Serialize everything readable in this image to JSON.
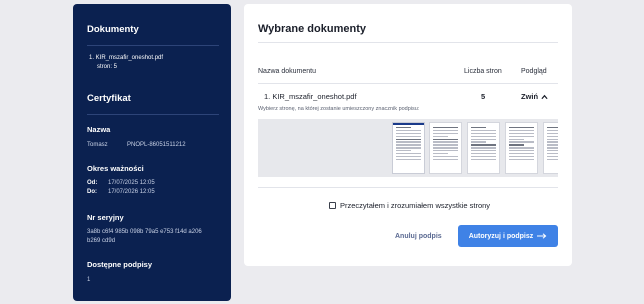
{
  "sidebar": {
    "documents_title": "Dokumenty",
    "documents": [
      {
        "name": "1. KIR_mszafir_oneshot.pdf",
        "pages": "stron: 5"
      }
    ],
    "certificate_title": "Certyfikat",
    "name_label": "Nazwa",
    "name_value": "Tomasz",
    "name_id": "PNOPL-86051511212",
    "validity_label": "Okres ważności",
    "from_label": "Od:",
    "from_value": "17/07/2025 12:05",
    "to_label": "Do:",
    "to_value": "17/07/2026 12:05",
    "serial_label": "Nr seryjny",
    "serial_line1": "3a8b c6f4 985b 098b 79a5 e753 f14d a206",
    "serial_line2": "b269 cd9d",
    "signatures_label": "Dostępne podpisy",
    "signatures_value": "1"
  },
  "main": {
    "title": "Wybrane dokumenty",
    "col_name": "Nazwa dokumentu",
    "col_pages": "Liczba stron",
    "col_preview": "Podgląd",
    "row": {
      "name": "1. KIR_mszafir_oneshot.pdf",
      "pages": "5",
      "toggle": "Zwiń"
    },
    "hint": "Wybierz stronę, na której zostanie umieszczony znacznik podpisu:",
    "selected_page": 1,
    "page_count": 5,
    "confirm_label": "Przeczytałem i zrozumiałem wszystkie strony",
    "confirm_checked": false,
    "cancel_label": "Anuluj podpis",
    "authorize_label": "Autoryzuj i podpisz"
  },
  "icons": {
    "chevron": "chevron-up-icon",
    "arrow": "arrow-right-icon"
  },
  "colors": {
    "sidebar_bg": "#0b2150",
    "primary_button": "#3f82e6",
    "page_bg": "#ebebef"
  }
}
